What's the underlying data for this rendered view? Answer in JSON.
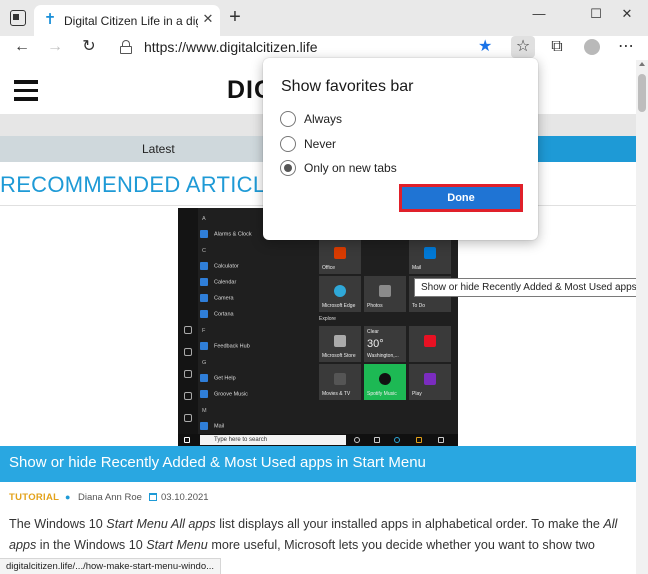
{
  "browser": {
    "tab": {
      "title": "Digital Citizen Life in a digital wo",
      "favicon": "✝",
      "close": "✕"
    },
    "new_tab": "+",
    "window_controls": {
      "minimize": "—",
      "maximize": "☐",
      "close": "✕"
    },
    "nav": {
      "back": "←",
      "forward": "→",
      "refresh": "↻",
      "favorites_star": "★",
      "favorites_button": "☆",
      "collections": "⧉",
      "profile": "",
      "more": "⋯"
    },
    "url": "https://www.digitalcitizen.life",
    "status_url": "digitalcitizen.life/.../how-make-start-menu-windo..."
  },
  "page": {
    "logo": "DIG",
    "menu_latest": "Latest",
    "recommended": "RECOMMENDED ARTICLES",
    "tooltip": "Show or hide Recently Added & Most Used apps in Start",
    "article": {
      "title": "Show or hide Recently Added & Most Used apps in Start Menu",
      "category": "TUTORIAL",
      "author": "Diana Ann Roe",
      "date": "03.10.2021",
      "body_parts": [
        "The Windows 10 ",
        "Start Menu All apps",
        " list displays all your installed apps in alphabetical order. To make the ",
        "All apps",
        " in the Windows 10 ",
        "Start Menu",
        " more useful, Microsoft lets you decide whether you want to show two additional"
      ]
    },
    "start_menu": {
      "letter_a": "A",
      "letter_c": "C",
      "letter_f": "F",
      "letter_g": "G",
      "letter_m": "M",
      "apps": [
        "Alarms & Clock",
        "Calculator",
        "Calendar",
        "Camera",
        "Cortana",
        "Feedback Hub",
        "Get Help",
        "Groove Music",
        "Mail"
      ],
      "tiles": [
        "Office",
        "Mail",
        "Microsoft Edge",
        "Photos",
        "To Do",
        "Microsoft Store",
        "Washington,...",
        "Movies & TV",
        "Spotify Music",
        "Play"
      ],
      "section_explore": "Explore",
      "weather": "30°",
      "weather_label": "Clear",
      "search_placeholder": "Type here to search"
    }
  },
  "popup": {
    "title": "Show favorites bar",
    "options": [
      {
        "label": "Always",
        "checked": false
      },
      {
        "label": "Never",
        "checked": false
      },
      {
        "label": "Only on new tabs",
        "checked": true
      }
    ],
    "done": "Done"
  },
  "colors": {
    "accent": "#1e9ad6",
    "done_button": "#1f74d4",
    "highlight_outline": "#e0202a",
    "tutorial": "#e3a21a"
  }
}
